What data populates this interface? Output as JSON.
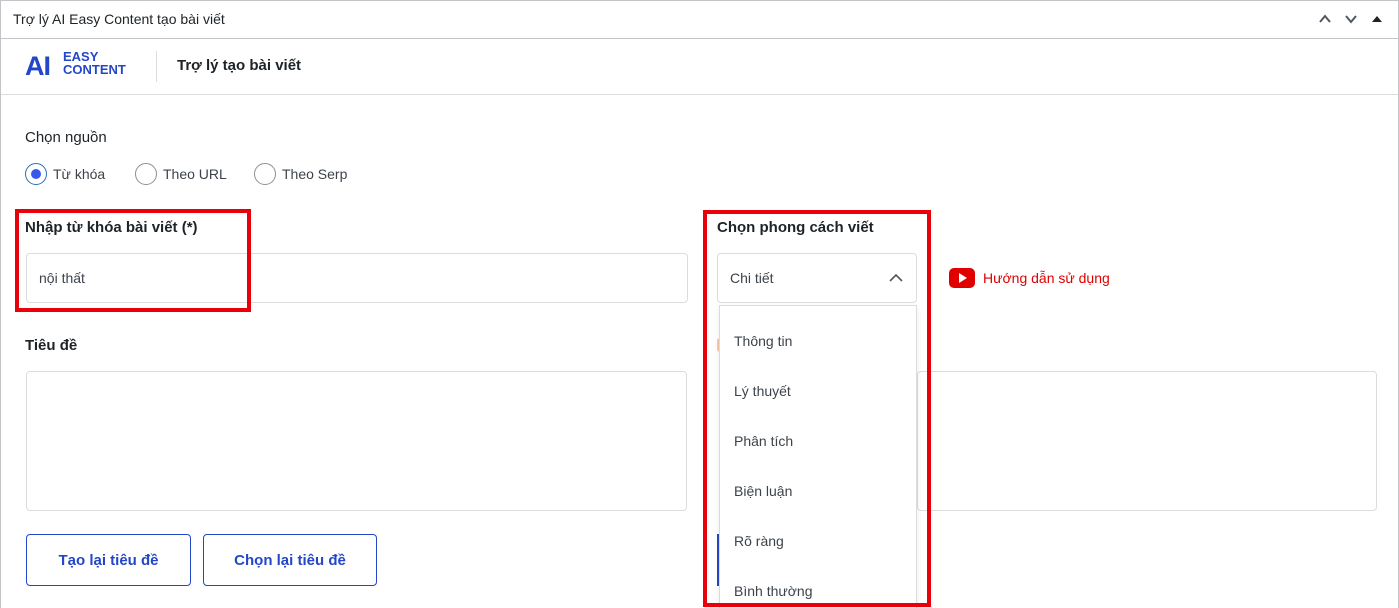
{
  "panel": {
    "title": "Trợ lý AI Easy Content tạo bài viết",
    "collapse_up_icon": "chevron-up-icon",
    "collapse_down_icon": "chevron-down-icon"
  },
  "brand": {
    "logo_ai": "AI",
    "logo_easy": "EASY",
    "logo_content": "CONTENT",
    "title": "Trợ lý tạo bài viết",
    "accent_color": "#2447c9"
  },
  "source": {
    "label": "Chọn nguồn",
    "options": [
      {
        "label": "Từ khóa",
        "checked": true
      },
      {
        "label": "Theo URL",
        "checked": false
      },
      {
        "label": "Theo Serp",
        "checked": false
      }
    ]
  },
  "keyword": {
    "label": "Nhập từ khóa bài viết (*)",
    "value": "nội thất"
  },
  "style": {
    "label": "Chọn phong cách viết",
    "selected": "Chi tiết",
    "options": [
      "Thông tin",
      "Lý thuyết",
      "Phân tích",
      "Biện luận",
      "Rõ ràng",
      "Bình thường"
    ]
  },
  "guide": {
    "icon": "youtube-icon",
    "label": "Hướng dẫn sử dụng",
    "color": "#e00000"
  },
  "title_field": {
    "label": "Tiêu đề",
    "value": ""
  },
  "buttons": {
    "regenerate": "Tạo lại tiêu đề",
    "reselect": "Chọn lại tiêu đề"
  },
  "highlight_color": "#e8000b"
}
